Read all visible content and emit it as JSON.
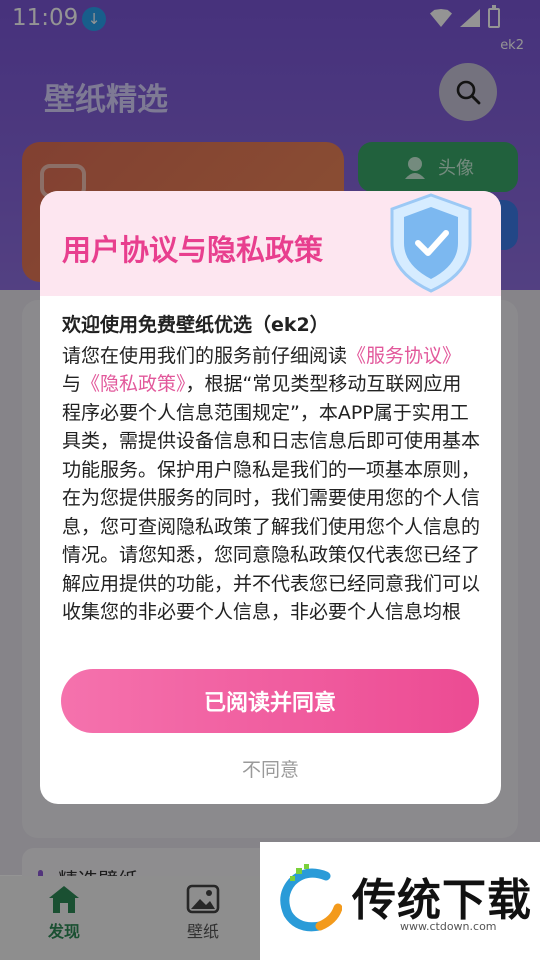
{
  "status_bar": {
    "time": "11:09",
    "badge": "ek2"
  },
  "page": {
    "title": "壁纸精选"
  },
  "chips": {
    "avatar_label": "头像"
  },
  "section": {
    "title": "精选壁纸"
  },
  "tabbar": {
    "tabs": [
      {
        "label": "发现",
        "active": true,
        "color": "#2e8b57"
      },
      {
        "label": "壁纸",
        "active": false,
        "color": "#555555"
      }
    ]
  },
  "dialog": {
    "title": "用户协议与隐私政策",
    "subtitle": "欢迎使用免费壁纸优选（ek2）",
    "body": {
      "intro": "请您在使用我们的服务前仔细阅读",
      "link_service": "《服务协议》",
      "conj": "与",
      "link_privacy": "《隐私政策》",
      "rest": "，根据“常见类型移动互联网应用程序必要个人信息范围规定”，本APP属于实用工具类，需提供设备信息和日志信息后即可使用基本功能服务。保护用户隐私是我们的一项基本原则，在为您提供服务的同时，我们需要使用您的个人信息，您可查阅隐私政策了解我们使用您个人信息的情况。请您知悉，您同意隐私政策仅代表您已经了解应用提供的功能，并不代表您已经同意我们可以收集您的非必要个人信息，非必要个人信息均根"
    },
    "agree_button": "已阅读并同意",
    "disagree_button": "不同意"
  },
  "watermark": {
    "title": "传统下载",
    "url": "www.ctdown.com"
  },
  "colors": {
    "header": "#7a56d6",
    "accent_pink": "#e83f8e",
    "button_start": "#f572ad",
    "button_end": "#ec4b93"
  }
}
